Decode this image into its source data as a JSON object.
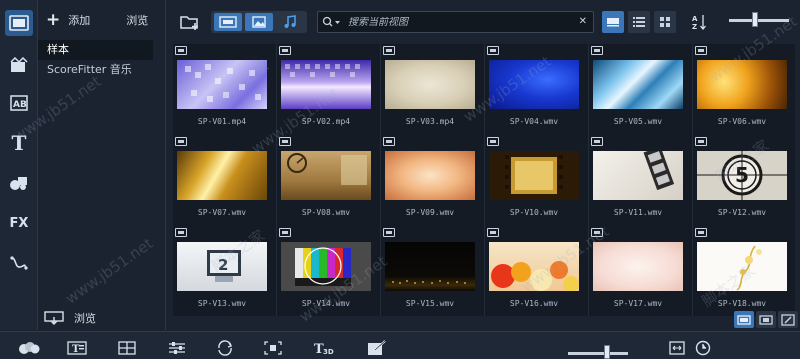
{
  "tree": {
    "add_label": "添加",
    "browse_label": "浏览",
    "items": [
      {
        "label": "样本"
      },
      {
        "label": "ScoreFitter 音乐"
      }
    ],
    "bottom_browse_label": "浏览"
  },
  "search": {
    "placeholder": "搜索当前视图"
  },
  "clips": [
    {
      "name": "SP-V01.mp4"
    },
    {
      "name": "SP-V02.mp4"
    },
    {
      "name": "SP-V03.mp4"
    },
    {
      "name": "SP-V04.wmv"
    },
    {
      "name": "SP-V05.wmv"
    },
    {
      "name": "SP-V06.wmv"
    },
    {
      "name": "SP-V07.wmv"
    },
    {
      "name": "SP-V08.wmv"
    },
    {
      "name": "SP-V09.wmv"
    },
    {
      "name": "SP-V10.wmv"
    },
    {
      "name": "SP-V11.wmv"
    },
    {
      "name": "SP-V12.wmv"
    },
    {
      "name": "SP-V13.wmv"
    },
    {
      "name": "SP-V14.wmv"
    },
    {
      "name": "SP-V15.wmv"
    },
    {
      "name": "SP-V16.wmv"
    },
    {
      "name": "SP-V17.wmv"
    },
    {
      "name": "SP-V18.wmv"
    }
  ],
  "watermark": {
    "cn": "脚本之家",
    "url": "www.jb51.net"
  },
  "colors": {
    "accent": "#3a76b8",
    "background": "#1b2330"
  }
}
